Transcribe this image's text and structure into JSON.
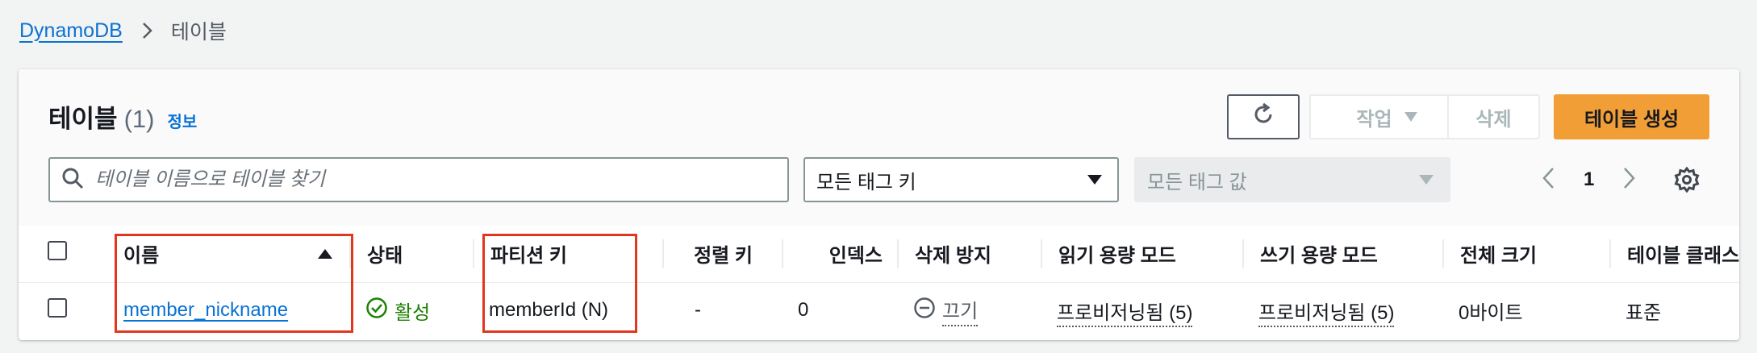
{
  "breadcrumb": {
    "service": "DynamoDB",
    "current": "테이블"
  },
  "header": {
    "title": "테이블",
    "count": "(1)",
    "info": "정보"
  },
  "toolbar": {
    "refresh_icon": "refresh-icon",
    "actions_label": "작업",
    "delete_label": "삭제",
    "create_label": "테이블 생성"
  },
  "filters": {
    "search_placeholder": "테이블 이름으로 테이블 찾기",
    "tag_key": "모든 태그 키",
    "tag_value": "모든 태그 값"
  },
  "pagination": {
    "current_page": "1"
  },
  "columns": [
    "이름",
    "상태",
    "파티션 키",
    "정렬 키",
    "인덱스",
    "삭제 방지",
    "읽기 용량 모드",
    "쓰기 용량 모드",
    "전체 크기",
    "테이블 클래스"
  ],
  "rows": [
    {
      "name": "member_nickname",
      "status": "활성",
      "partition_key": "memberId (N)",
      "sort_key": "-",
      "indexes": "0",
      "deletion_protection": "끄기",
      "read_mode": "프로비저닝됨 (5)",
      "write_mode": "프로비저닝됨 (5)",
      "size": "0바이트",
      "table_class": "표준"
    }
  ],
  "colors": {
    "accent": "#0972d3",
    "primary_button": "#f19e36",
    "success": "#1d8102",
    "highlight": "#e0371f"
  }
}
